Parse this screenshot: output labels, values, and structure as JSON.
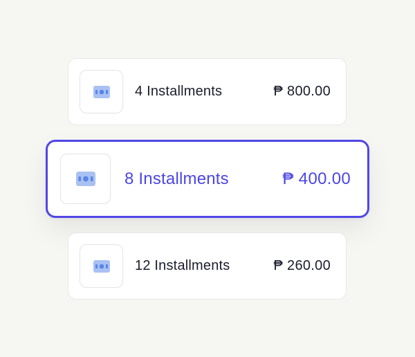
{
  "installment_options": [
    {
      "label": "4 Installments",
      "amount": "₱ 800.00",
      "icon": "cash-icon",
      "selected": false
    },
    {
      "label": "8 Installments",
      "amount": "₱ 400.00",
      "icon": "cash-icon",
      "selected": true
    },
    {
      "label": "12 Installments",
      "amount": "₱ 260.00",
      "icon": "cash-icon",
      "selected": false
    }
  ],
  "colors": {
    "accent": "#4b46e3",
    "icon": "#5a84e6",
    "icon_light": "#a9c1f3",
    "text": "#1a1c2c",
    "background": "#f6f6f3"
  }
}
